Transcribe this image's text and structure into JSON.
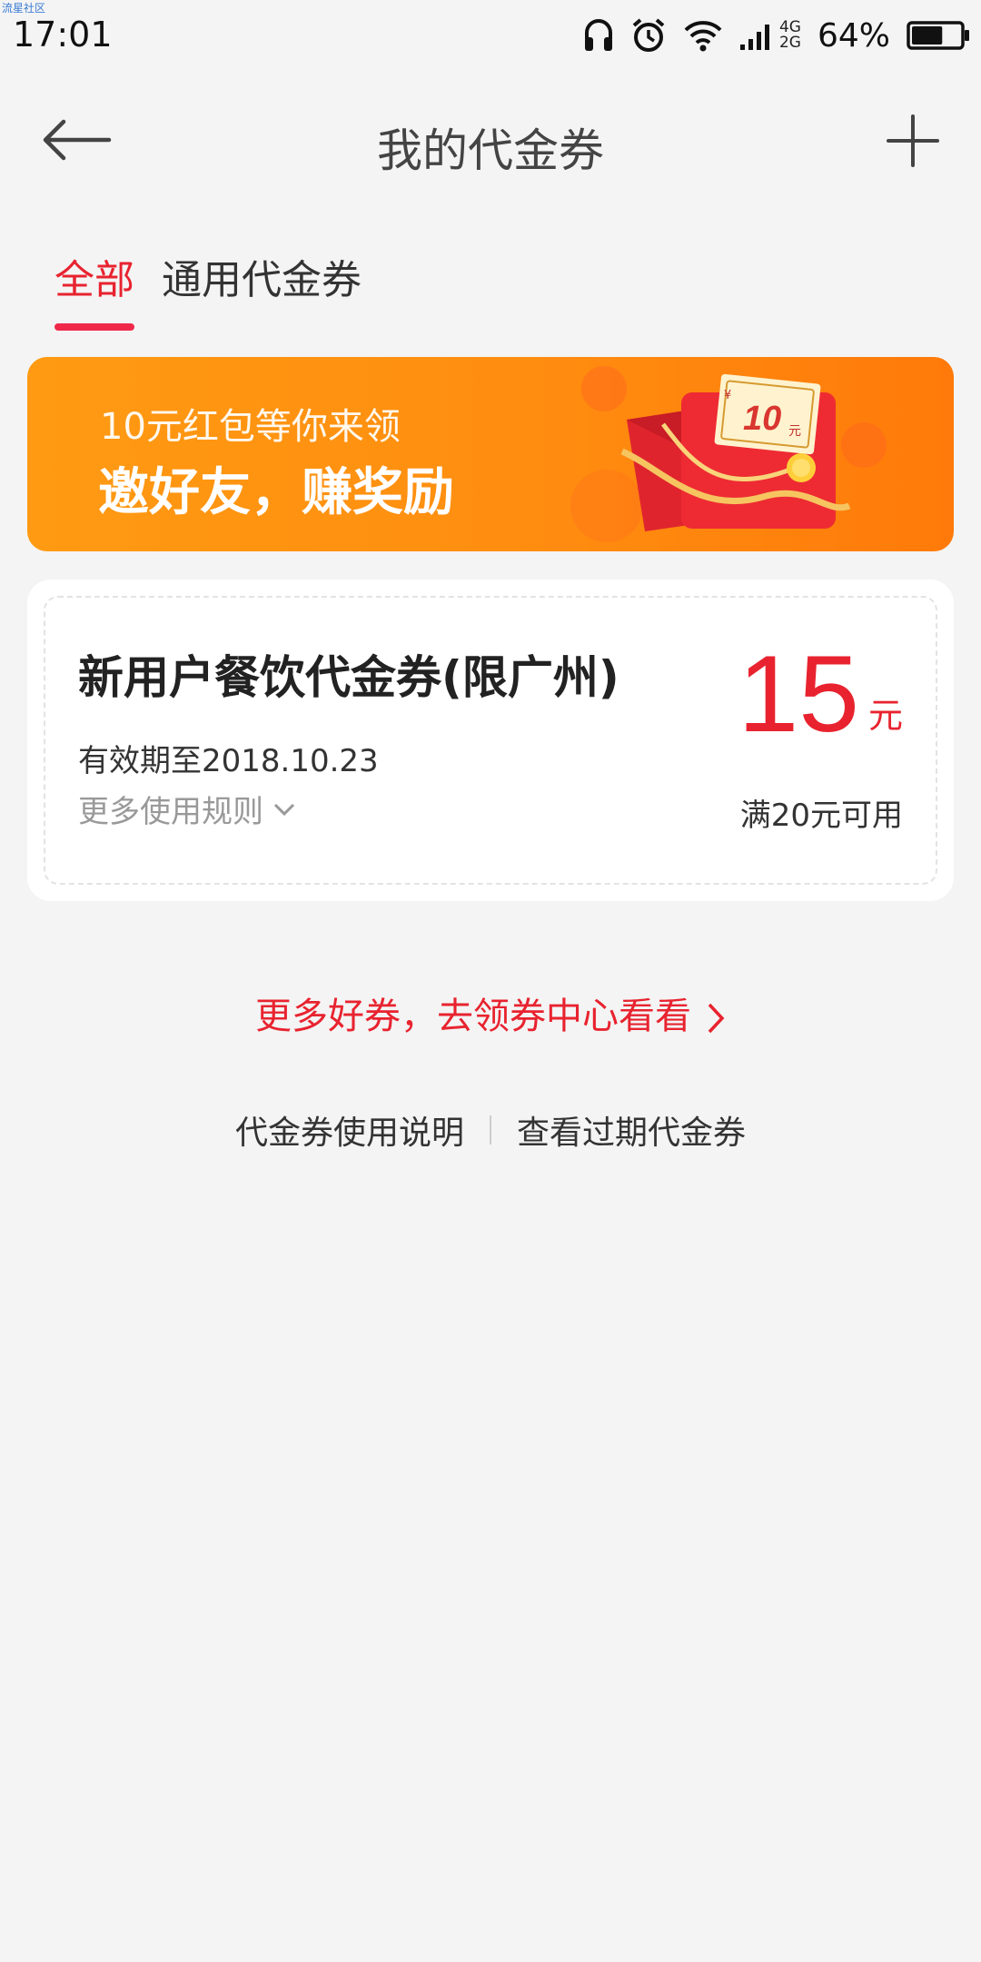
{
  "status_bar": {
    "tiny_text": "流星社区",
    "time": "17:01",
    "network_top": "4G",
    "network_bottom": "2G",
    "battery": "64%",
    "battery_level": 0.64,
    "icons": [
      "headset-icon",
      "alarm-icon",
      "wifi-icon",
      "signal-icon",
      "battery-icon"
    ]
  },
  "header": {
    "title": "我的代金券",
    "back_icon": "arrow-left-icon",
    "add_icon": "plus-icon"
  },
  "tabs": [
    {
      "label": "全部",
      "active": true
    },
    {
      "label": "通用代金券",
      "active": false
    }
  ],
  "banner": {
    "subtitle": "10元红包等你来领",
    "title": "邀好友，赚奖励",
    "envelope_amount": "10",
    "envelope_unit": "元",
    "envelope_currency": "¥"
  },
  "coupon": {
    "title": "新用户餐饮代金券(限广州)",
    "expiry": "有效期至2018.10.23",
    "rules": "更多使用规则",
    "amount": "15",
    "unit": "元",
    "condition": "满20元可用"
  },
  "more_link": "更多好券，去领券中心看看",
  "footer": {
    "instructions": "代金券使用说明",
    "expired": "查看过期代金券"
  },
  "colors": {
    "accent": "#e8232f",
    "tab_underline": "#f0294a",
    "banner_start": "#ff9a12",
    "banner_end": "#ff7a0a",
    "background": "#f4f4f4"
  }
}
